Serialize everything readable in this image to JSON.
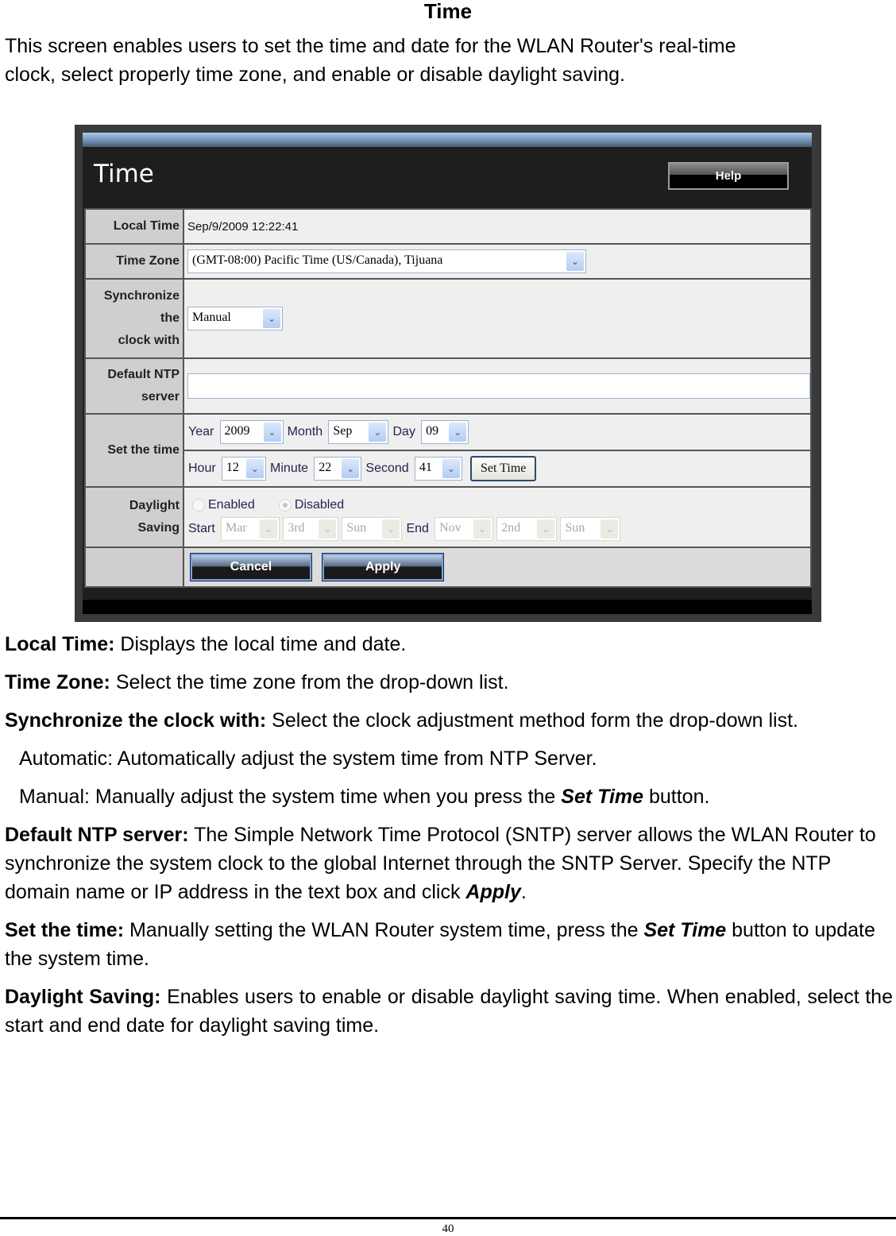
{
  "doc": {
    "title": "Time",
    "intro_lines": [
      "This screen enables users to set the time and date for the WLAN Router's real-time",
      "clock, select properly time zone, and enable or disable daylight saving."
    ],
    "page_number": "40"
  },
  "screenshot": {
    "title": "Time",
    "help_label": "Help",
    "accent_colors": {
      "top_bar": "#8fb0dc",
      "label_bg": "#cfcfcf",
      "value_bg": "#efefef",
      "frame": "#1e1e1e"
    },
    "rows": {
      "local_time": {
        "label": "Local Time",
        "value": "Sep/9/2009 12:22:41"
      },
      "time_zone": {
        "label": "Time Zone",
        "selected": "(GMT-08:00) Pacific Time (US/Canada), Tijuana"
      },
      "sync": {
        "label_lines": [
          "Synchronize",
          "the",
          "clock with"
        ],
        "selected": "Manual"
      },
      "ntp": {
        "label_lines": [
          "Default NTP",
          "server"
        ],
        "value": ""
      },
      "set_time": {
        "label": "Set the time",
        "year_label": "Year",
        "year": "2009",
        "month_label": "Month",
        "month": "Sep",
        "day_label": "Day",
        "day": "09",
        "hour_label": "Hour",
        "hour": "12",
        "minute_label": "Minute",
        "minute": "22",
        "second_label": "Second",
        "second": "41",
        "set_time_button": "Set Time"
      },
      "daylight": {
        "label_lines": [
          "Daylight",
          "Saving"
        ],
        "enabled_label": "Enabled",
        "disabled_label": "Disabled",
        "selected": "Disabled",
        "start_label": "Start",
        "start_month": "Mar",
        "start_week": "3rd",
        "start_day": "Sun",
        "end_label": "End",
        "end_month": "Nov",
        "end_week": "2nd",
        "end_day": "Sun"
      },
      "buttons": {
        "cancel": "Cancel",
        "apply": "Apply"
      }
    },
    "icons": {
      "dropdown_arrow": "⌄"
    }
  },
  "descriptions": {
    "local_time": {
      "term": "Local Time:",
      "text": " Displays the local time and date."
    },
    "time_zone": {
      "term": "Time Zone:",
      "text": " Select the time zone from the drop-down list."
    },
    "sync": {
      "term": "Synchronize the clock with:",
      "text": " Select the clock adjustment method form the drop-down list."
    },
    "automatic": "Automatic: Automatically adjust the system time from NTP Server.",
    "manual_pre": "Manual: Manually adjust the system time when you press the ",
    "manual_em": "Set Time",
    "manual_post": " button.",
    "ntp": {
      "term": "Default NTP server:",
      "text": " The Simple Network Time Protocol (SNTP) server allows the WLAN Router to synchronize the system clock to the global Internet through the SNTP Server. Specify the NTP domain name or IP address in the text box and click ",
      "em": "Apply",
      "post": "."
    },
    "set_time": {
      "term": "Set the time:",
      "text": " Manually setting the WLAN Router system time, press the ",
      "em": "Set Time",
      "post": " button to update the system time."
    },
    "daylight": {
      "term": "Daylight Saving:",
      "text": " Enables users to enable or disable daylight saving time. When enabled, select the start and end date for daylight saving time."
    }
  }
}
